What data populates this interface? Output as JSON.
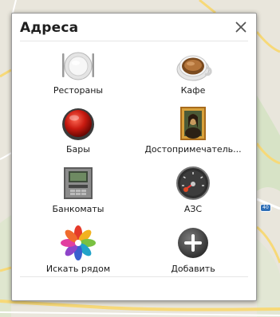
{
  "dialog": {
    "title": "Адреса",
    "close_label": "×"
  },
  "places": [
    {
      "label": "Рестораны",
      "icon": "restaurant-plate-icon"
    },
    {
      "label": "Кафе",
      "icon": "coffee-cup-icon"
    },
    {
      "label": "Бары",
      "icon": "bar-red-button-icon"
    },
    {
      "label": "Достопримечатель...",
      "icon": "mona-lisa-painting-icon"
    },
    {
      "label": "Банкоматы",
      "icon": "atm-machine-icon"
    },
    {
      "label": "АЗС",
      "icon": "gas-station-gauge-icon"
    },
    {
      "label": "Искать рядом",
      "icon": "flower-search-icon"
    },
    {
      "label": "Добавить",
      "icon": "add-plus-icon"
    }
  ],
  "map": {
    "marker_label": "40"
  },
  "colors": {
    "map_background": "#e9e6dc",
    "road_yellow": "#f7d978",
    "dialog_background": "#ffffff"
  }
}
